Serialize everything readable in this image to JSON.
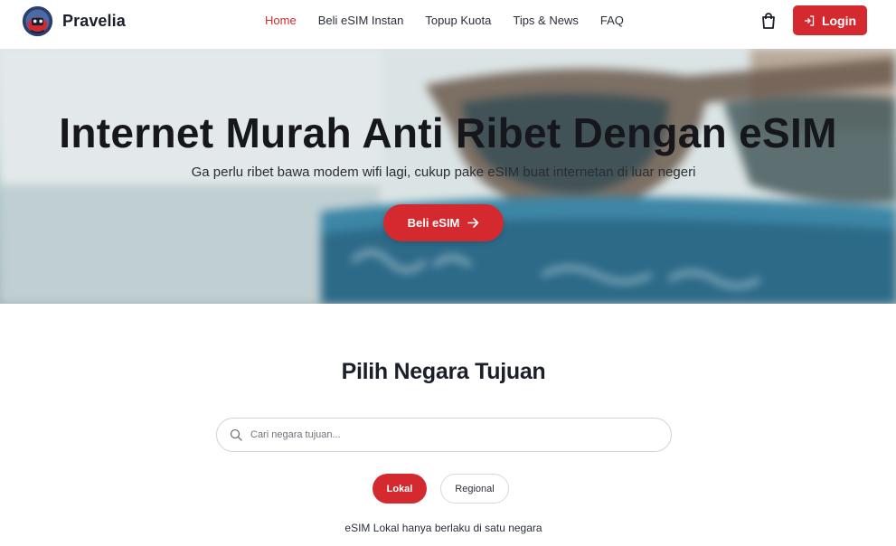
{
  "brand": {
    "name": "Pravelia"
  },
  "nav": {
    "links": [
      {
        "label": "Home",
        "active": true
      },
      {
        "label": "Beli eSIM Instan"
      },
      {
        "label": "Topup Kuota"
      },
      {
        "label": "Tips & News"
      },
      {
        "label": "FAQ"
      }
    ],
    "cart_icon": "shopping-bag-icon",
    "login_label": "Login",
    "login_icon": "login-arrow-icon"
  },
  "hero": {
    "title": "Internet Murah Anti Ribet Dengan eSIM",
    "subtitle": "Ga perlu ribet bawa modem wifi lagi, cukup pake eSIM buat internetan di luar negeri",
    "cta_label": "Beli eSIM",
    "cta_icon": "arrow-right-icon"
  },
  "destination": {
    "title": "Pilih Negara Tujuan",
    "search_placeholder": "Cari negara tujuan...",
    "search_icon": "search-icon",
    "tabs": [
      {
        "label": "Lokal",
        "active": true
      },
      {
        "label": "Regional"
      }
    ],
    "note": "eSIM Lokal hanya berlaku di satu negara"
  },
  "colors": {
    "accent": "#d42a2f",
    "text_dark": "#1b1f2a"
  }
}
